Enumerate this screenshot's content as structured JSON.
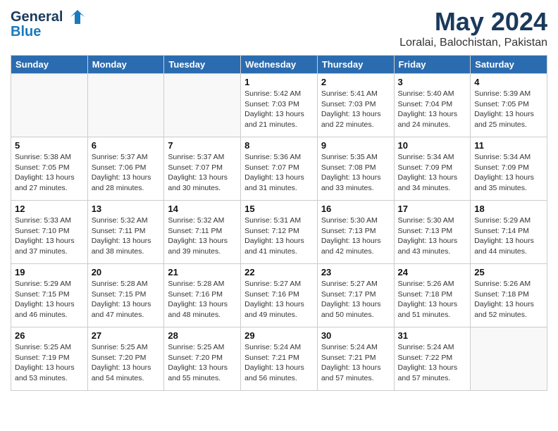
{
  "header": {
    "logo_line1": "General",
    "logo_line2": "Blue",
    "month_year": "May 2024",
    "location": "Loralai, Balochistan, Pakistan"
  },
  "weekdays": [
    "Sunday",
    "Monday",
    "Tuesday",
    "Wednesday",
    "Thursday",
    "Friday",
    "Saturday"
  ],
  "weeks": [
    [
      {
        "date": "",
        "info": ""
      },
      {
        "date": "",
        "info": ""
      },
      {
        "date": "",
        "info": ""
      },
      {
        "date": "1",
        "info": "Sunrise: 5:42 AM\nSunset: 7:03 PM\nDaylight: 13 hours\nand 21 minutes."
      },
      {
        "date": "2",
        "info": "Sunrise: 5:41 AM\nSunset: 7:03 PM\nDaylight: 13 hours\nand 22 minutes."
      },
      {
        "date": "3",
        "info": "Sunrise: 5:40 AM\nSunset: 7:04 PM\nDaylight: 13 hours\nand 24 minutes."
      },
      {
        "date": "4",
        "info": "Sunrise: 5:39 AM\nSunset: 7:05 PM\nDaylight: 13 hours\nand 25 minutes."
      }
    ],
    [
      {
        "date": "5",
        "info": "Sunrise: 5:38 AM\nSunset: 7:05 PM\nDaylight: 13 hours\nand 27 minutes."
      },
      {
        "date": "6",
        "info": "Sunrise: 5:37 AM\nSunset: 7:06 PM\nDaylight: 13 hours\nand 28 minutes."
      },
      {
        "date": "7",
        "info": "Sunrise: 5:37 AM\nSunset: 7:07 PM\nDaylight: 13 hours\nand 30 minutes."
      },
      {
        "date": "8",
        "info": "Sunrise: 5:36 AM\nSunset: 7:07 PM\nDaylight: 13 hours\nand 31 minutes."
      },
      {
        "date": "9",
        "info": "Sunrise: 5:35 AM\nSunset: 7:08 PM\nDaylight: 13 hours\nand 33 minutes."
      },
      {
        "date": "10",
        "info": "Sunrise: 5:34 AM\nSunset: 7:09 PM\nDaylight: 13 hours\nand 34 minutes."
      },
      {
        "date": "11",
        "info": "Sunrise: 5:34 AM\nSunset: 7:09 PM\nDaylight: 13 hours\nand 35 minutes."
      }
    ],
    [
      {
        "date": "12",
        "info": "Sunrise: 5:33 AM\nSunset: 7:10 PM\nDaylight: 13 hours\nand 37 minutes."
      },
      {
        "date": "13",
        "info": "Sunrise: 5:32 AM\nSunset: 7:11 PM\nDaylight: 13 hours\nand 38 minutes."
      },
      {
        "date": "14",
        "info": "Sunrise: 5:32 AM\nSunset: 7:11 PM\nDaylight: 13 hours\nand 39 minutes."
      },
      {
        "date": "15",
        "info": "Sunrise: 5:31 AM\nSunset: 7:12 PM\nDaylight: 13 hours\nand 41 minutes."
      },
      {
        "date": "16",
        "info": "Sunrise: 5:30 AM\nSunset: 7:13 PM\nDaylight: 13 hours\nand 42 minutes."
      },
      {
        "date": "17",
        "info": "Sunrise: 5:30 AM\nSunset: 7:13 PM\nDaylight: 13 hours\nand 43 minutes."
      },
      {
        "date": "18",
        "info": "Sunrise: 5:29 AM\nSunset: 7:14 PM\nDaylight: 13 hours\nand 44 minutes."
      }
    ],
    [
      {
        "date": "19",
        "info": "Sunrise: 5:29 AM\nSunset: 7:15 PM\nDaylight: 13 hours\nand 46 minutes."
      },
      {
        "date": "20",
        "info": "Sunrise: 5:28 AM\nSunset: 7:15 PM\nDaylight: 13 hours\nand 47 minutes."
      },
      {
        "date": "21",
        "info": "Sunrise: 5:28 AM\nSunset: 7:16 PM\nDaylight: 13 hours\nand 48 minutes."
      },
      {
        "date": "22",
        "info": "Sunrise: 5:27 AM\nSunset: 7:16 PM\nDaylight: 13 hours\nand 49 minutes."
      },
      {
        "date": "23",
        "info": "Sunrise: 5:27 AM\nSunset: 7:17 PM\nDaylight: 13 hours\nand 50 minutes."
      },
      {
        "date": "24",
        "info": "Sunrise: 5:26 AM\nSunset: 7:18 PM\nDaylight: 13 hours\nand 51 minutes."
      },
      {
        "date": "25",
        "info": "Sunrise: 5:26 AM\nSunset: 7:18 PM\nDaylight: 13 hours\nand 52 minutes."
      }
    ],
    [
      {
        "date": "26",
        "info": "Sunrise: 5:25 AM\nSunset: 7:19 PM\nDaylight: 13 hours\nand 53 minutes."
      },
      {
        "date": "27",
        "info": "Sunrise: 5:25 AM\nSunset: 7:20 PM\nDaylight: 13 hours\nand 54 minutes."
      },
      {
        "date": "28",
        "info": "Sunrise: 5:25 AM\nSunset: 7:20 PM\nDaylight: 13 hours\nand 55 minutes."
      },
      {
        "date": "29",
        "info": "Sunrise: 5:24 AM\nSunset: 7:21 PM\nDaylight: 13 hours\nand 56 minutes."
      },
      {
        "date": "30",
        "info": "Sunrise: 5:24 AM\nSunset: 7:21 PM\nDaylight: 13 hours\nand 57 minutes."
      },
      {
        "date": "31",
        "info": "Sunrise: 5:24 AM\nSunset: 7:22 PM\nDaylight: 13 hours\nand 57 minutes."
      },
      {
        "date": "",
        "info": ""
      }
    ]
  ]
}
